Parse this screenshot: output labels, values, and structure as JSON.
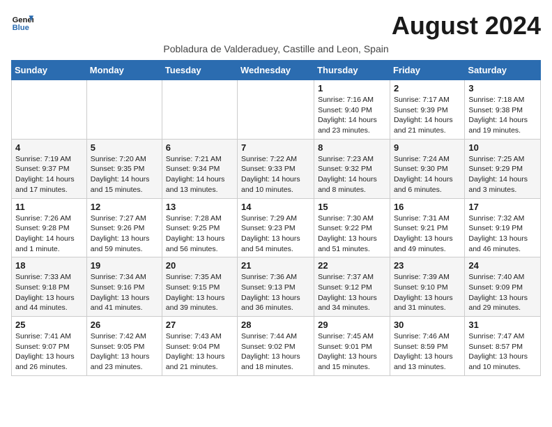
{
  "header": {
    "logo_line1": "General",
    "logo_line2": "Blue",
    "month_title": "August 2024",
    "subtitle": "Pobladura de Valderaduey, Castille and Leon, Spain"
  },
  "weekdays": [
    "Sunday",
    "Monday",
    "Tuesday",
    "Wednesday",
    "Thursday",
    "Friday",
    "Saturday"
  ],
  "weeks": [
    [
      {
        "day": "",
        "info": ""
      },
      {
        "day": "",
        "info": ""
      },
      {
        "day": "",
        "info": ""
      },
      {
        "day": "",
        "info": ""
      },
      {
        "day": "1",
        "info": "Sunrise: 7:16 AM\nSunset: 9:40 PM\nDaylight: 14 hours and 23 minutes."
      },
      {
        "day": "2",
        "info": "Sunrise: 7:17 AM\nSunset: 9:39 PM\nDaylight: 14 hours and 21 minutes."
      },
      {
        "day": "3",
        "info": "Sunrise: 7:18 AM\nSunset: 9:38 PM\nDaylight: 14 hours and 19 minutes."
      }
    ],
    [
      {
        "day": "4",
        "info": "Sunrise: 7:19 AM\nSunset: 9:37 PM\nDaylight: 14 hours and 17 minutes."
      },
      {
        "day": "5",
        "info": "Sunrise: 7:20 AM\nSunset: 9:35 PM\nDaylight: 14 hours and 15 minutes."
      },
      {
        "day": "6",
        "info": "Sunrise: 7:21 AM\nSunset: 9:34 PM\nDaylight: 14 hours and 13 minutes."
      },
      {
        "day": "7",
        "info": "Sunrise: 7:22 AM\nSunset: 9:33 PM\nDaylight: 14 hours and 10 minutes."
      },
      {
        "day": "8",
        "info": "Sunrise: 7:23 AM\nSunset: 9:32 PM\nDaylight: 14 hours and 8 minutes."
      },
      {
        "day": "9",
        "info": "Sunrise: 7:24 AM\nSunset: 9:30 PM\nDaylight: 14 hours and 6 minutes."
      },
      {
        "day": "10",
        "info": "Sunrise: 7:25 AM\nSunset: 9:29 PM\nDaylight: 14 hours and 3 minutes."
      }
    ],
    [
      {
        "day": "11",
        "info": "Sunrise: 7:26 AM\nSunset: 9:28 PM\nDaylight: 14 hours and 1 minute."
      },
      {
        "day": "12",
        "info": "Sunrise: 7:27 AM\nSunset: 9:26 PM\nDaylight: 13 hours and 59 minutes."
      },
      {
        "day": "13",
        "info": "Sunrise: 7:28 AM\nSunset: 9:25 PM\nDaylight: 13 hours and 56 minutes."
      },
      {
        "day": "14",
        "info": "Sunrise: 7:29 AM\nSunset: 9:23 PM\nDaylight: 13 hours and 54 minutes."
      },
      {
        "day": "15",
        "info": "Sunrise: 7:30 AM\nSunset: 9:22 PM\nDaylight: 13 hours and 51 minutes."
      },
      {
        "day": "16",
        "info": "Sunrise: 7:31 AM\nSunset: 9:21 PM\nDaylight: 13 hours and 49 minutes."
      },
      {
        "day": "17",
        "info": "Sunrise: 7:32 AM\nSunset: 9:19 PM\nDaylight: 13 hours and 46 minutes."
      }
    ],
    [
      {
        "day": "18",
        "info": "Sunrise: 7:33 AM\nSunset: 9:18 PM\nDaylight: 13 hours and 44 minutes."
      },
      {
        "day": "19",
        "info": "Sunrise: 7:34 AM\nSunset: 9:16 PM\nDaylight: 13 hours and 41 minutes."
      },
      {
        "day": "20",
        "info": "Sunrise: 7:35 AM\nSunset: 9:15 PM\nDaylight: 13 hours and 39 minutes."
      },
      {
        "day": "21",
        "info": "Sunrise: 7:36 AM\nSunset: 9:13 PM\nDaylight: 13 hours and 36 minutes."
      },
      {
        "day": "22",
        "info": "Sunrise: 7:37 AM\nSunset: 9:12 PM\nDaylight: 13 hours and 34 minutes."
      },
      {
        "day": "23",
        "info": "Sunrise: 7:39 AM\nSunset: 9:10 PM\nDaylight: 13 hours and 31 minutes."
      },
      {
        "day": "24",
        "info": "Sunrise: 7:40 AM\nSunset: 9:09 PM\nDaylight: 13 hours and 29 minutes."
      }
    ],
    [
      {
        "day": "25",
        "info": "Sunrise: 7:41 AM\nSunset: 9:07 PM\nDaylight: 13 hours and 26 minutes."
      },
      {
        "day": "26",
        "info": "Sunrise: 7:42 AM\nSunset: 9:05 PM\nDaylight: 13 hours and 23 minutes."
      },
      {
        "day": "27",
        "info": "Sunrise: 7:43 AM\nSunset: 9:04 PM\nDaylight: 13 hours and 21 minutes."
      },
      {
        "day": "28",
        "info": "Sunrise: 7:44 AM\nSunset: 9:02 PM\nDaylight: 13 hours and 18 minutes."
      },
      {
        "day": "29",
        "info": "Sunrise: 7:45 AM\nSunset: 9:01 PM\nDaylight: 13 hours and 15 minutes."
      },
      {
        "day": "30",
        "info": "Sunrise: 7:46 AM\nSunset: 8:59 PM\nDaylight: 13 hours and 13 minutes."
      },
      {
        "day": "31",
        "info": "Sunrise: 7:47 AM\nSunset: 8:57 PM\nDaylight: 13 hours and 10 minutes."
      }
    ]
  ]
}
